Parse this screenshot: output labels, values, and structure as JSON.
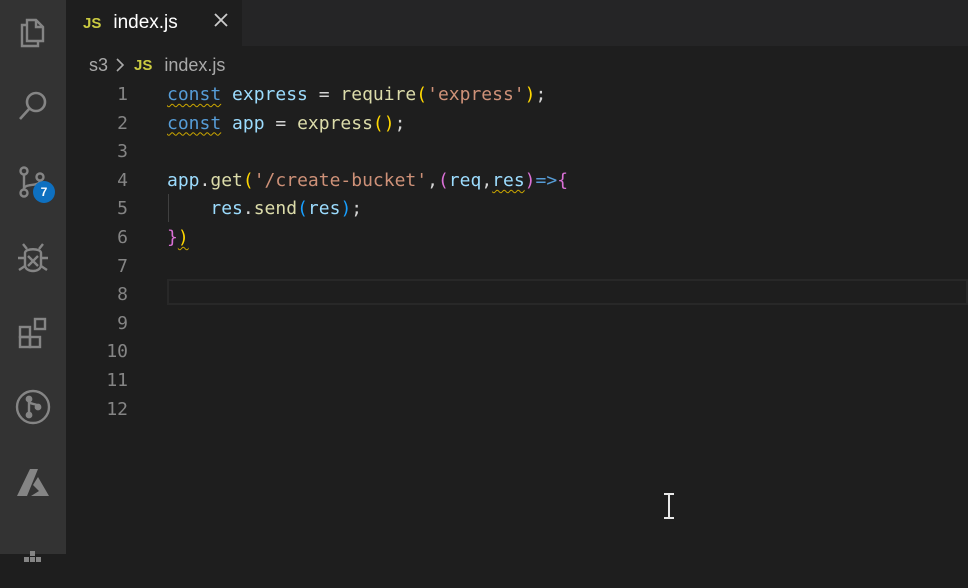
{
  "activity_bar": {
    "items": [
      {
        "name": "explorer-icon"
      },
      {
        "name": "search-icon"
      },
      {
        "name": "source-control-icon",
        "badge": "7"
      },
      {
        "name": "debug-icon"
      },
      {
        "name": "extensions-icon"
      },
      {
        "name": "git-graph-icon"
      },
      {
        "name": "azure-icon"
      },
      {
        "name": "docker-icon"
      }
    ]
  },
  "tab": {
    "lang_badge": "JS",
    "title": "index.js",
    "close_icon": "close-icon"
  },
  "breadcrumb": {
    "folder": "s3",
    "lang_badge": "JS",
    "file": "index.js"
  },
  "editor": {
    "line_numbers": [
      "1",
      "2",
      "3",
      "4",
      "5",
      "6",
      "7",
      "8",
      "9",
      "10",
      "11",
      "12"
    ],
    "lines": [
      [
        {
          "t": "const",
          "c": "kw squig"
        },
        {
          "t": " "
        },
        {
          "t": "express",
          "c": "var"
        },
        {
          "t": " = "
        },
        {
          "t": "require",
          "c": "fn"
        },
        {
          "t": "(",
          "c": "p1"
        },
        {
          "t": "'express'",
          "c": "str"
        },
        {
          "t": ")",
          "c": "p1"
        },
        {
          "t": ";"
        }
      ],
      [
        {
          "t": "const",
          "c": "kw squig"
        },
        {
          "t": " "
        },
        {
          "t": "app",
          "c": "var"
        },
        {
          "t": " = "
        },
        {
          "t": "express",
          "c": "fn"
        },
        {
          "t": "()",
          "c": "p1"
        },
        {
          "t": ";"
        }
      ],
      [],
      [
        {
          "t": "app",
          "c": "var"
        },
        {
          "t": "."
        },
        {
          "t": "get",
          "c": "fn"
        },
        {
          "t": "(",
          "c": "p1"
        },
        {
          "t": "'/create-bucket'",
          "c": "str"
        },
        {
          "t": ","
        },
        {
          "t": "(",
          "c": "p2"
        },
        {
          "t": "req",
          "c": "var"
        },
        {
          "t": ","
        },
        {
          "t": "res",
          "c": "var squig"
        },
        {
          "t": ")",
          "c": "p2"
        },
        {
          "t": "=>",
          "c": "kw"
        },
        {
          "t": "{",
          "c": "p2"
        }
      ],
      [
        {
          "t": "    "
        },
        {
          "t": "res",
          "c": "var"
        },
        {
          "t": "."
        },
        {
          "t": "send",
          "c": "fn"
        },
        {
          "t": "(",
          "c": "p3"
        },
        {
          "t": "res",
          "c": "var"
        },
        {
          "t": ")",
          "c": "p3"
        },
        {
          "t": ";"
        }
      ],
      [
        {
          "t": "}",
          "c": "p2"
        },
        {
          "t": ")",
          "c": "p1 squig"
        }
      ],
      [],
      [],
      [],
      [],
      [],
      []
    ]
  },
  "colors": {
    "editor_bg": "#1e1e1e",
    "activity_bg": "#333333",
    "tab_inactive_bg": "#252526",
    "badge_bg": "#0e70c0",
    "js_badge": "#cbcb41"
  }
}
